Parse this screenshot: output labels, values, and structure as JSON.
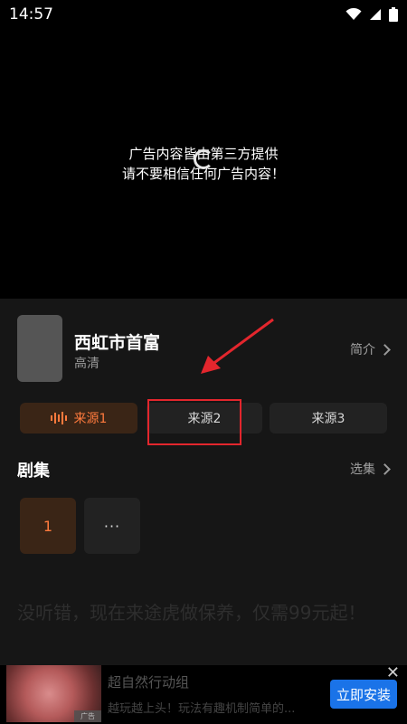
{
  "status_bar": {
    "time": "14:57",
    "icons": [
      "wifi-icon",
      "signal-icon",
      "battery-icon"
    ]
  },
  "player": {
    "notice_line1": "广告内容皆由第三方提供",
    "notice_line2": "请不要相信任何广告内容！"
  },
  "show": {
    "title": "西虹市首富",
    "quality": "高清",
    "intro_label": "简介"
  },
  "sources": [
    {
      "label": "来源1",
      "active": true
    },
    {
      "label": "来源2",
      "active": false
    },
    {
      "label": "来源3",
      "active": false
    }
  ],
  "episodes": {
    "heading": "剧集",
    "select_label": "选集",
    "items": [
      "1",
      "···"
    ]
  },
  "ad": {
    "headline": "没听错，现在来途虎做保养，仅需99元起！",
    "title": "超自然行动组",
    "description": "越玩越上头！玩法有趣机制简单的...",
    "badge": "广告",
    "install_label": "立即安装",
    "close_symbol": "✕"
  },
  "colors": {
    "accent": "#ff7a3d",
    "annotation": "#e3262d",
    "install": "#1a73e8"
  }
}
